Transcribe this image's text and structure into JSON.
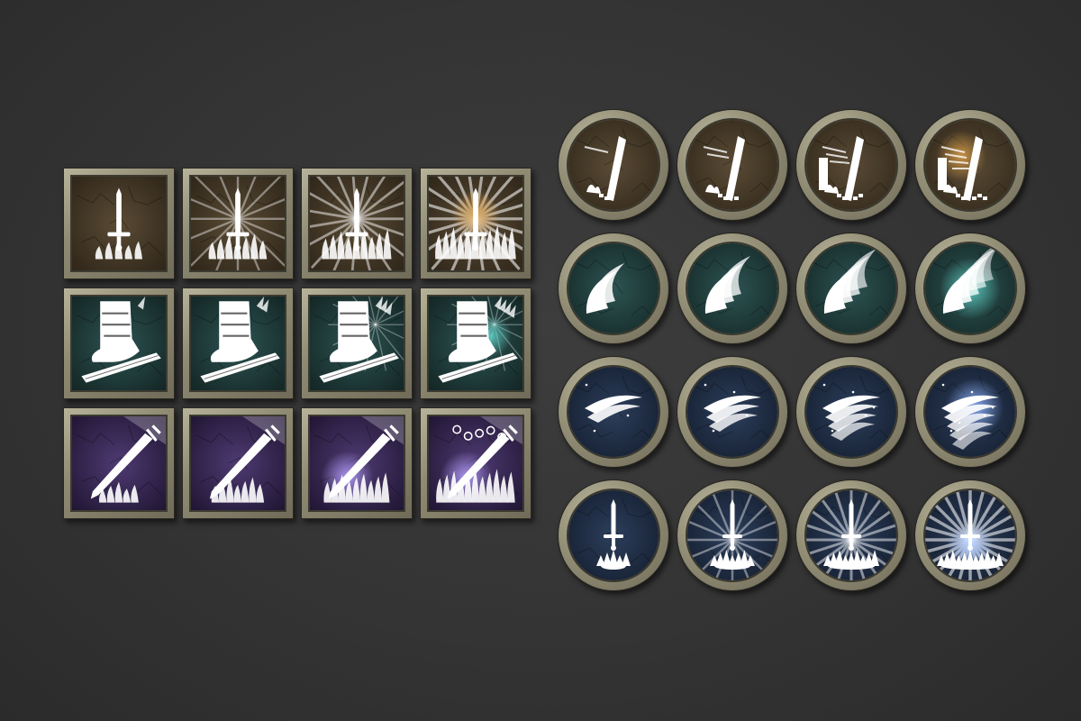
{
  "sets": [
    {
      "shape": "square",
      "theme": "brown",
      "bg": "#5a4b35",
      "bgDark": "#2f2619",
      "glow": "#d49a45",
      "motif": "sword-burst"
    },
    {
      "shape": "square",
      "theme": "teal",
      "bg": "#2d5452",
      "bgDark": "#132625",
      "glow": "#5fd0c6",
      "motif": "boot-kick"
    },
    {
      "shape": "square",
      "theme": "purple",
      "bg": "#4e3a72",
      "bgDark": "#201633",
      "glow": "#b7a1ff",
      "motif": "flaming-blade"
    },
    {
      "shape": "round",
      "theme": "brown",
      "bg": "#5a4b35",
      "bgDark": "#2f2619",
      "glow": "#d49a45",
      "motif": "rising-slash"
    },
    {
      "shape": "round",
      "theme": "teal",
      "bg": "#2d5452",
      "bgDark": "#132625",
      "glow": "#5fd0c6",
      "motif": "crescent-wave"
    },
    {
      "shape": "round",
      "theme": "navy",
      "bg": "#2d3f5c",
      "bgDark": "#121b2b",
      "glow": "#8fb4ff",
      "motif": "wind-slash"
    },
    {
      "shape": "round",
      "theme": "navy",
      "bg": "#2d3f5c",
      "bgDark": "#121b2b",
      "glow": "#a9c6ff",
      "motif": "sword-impact"
    }
  ],
  "levels": [
    1,
    2,
    3,
    4
  ],
  "icons": [
    "sword-burst-icon",
    "boot-kick-icon",
    "flaming-blade-icon",
    "rising-slash-icon",
    "crescent-wave-icon",
    "wind-slash-icon",
    "sword-impact-icon"
  ]
}
